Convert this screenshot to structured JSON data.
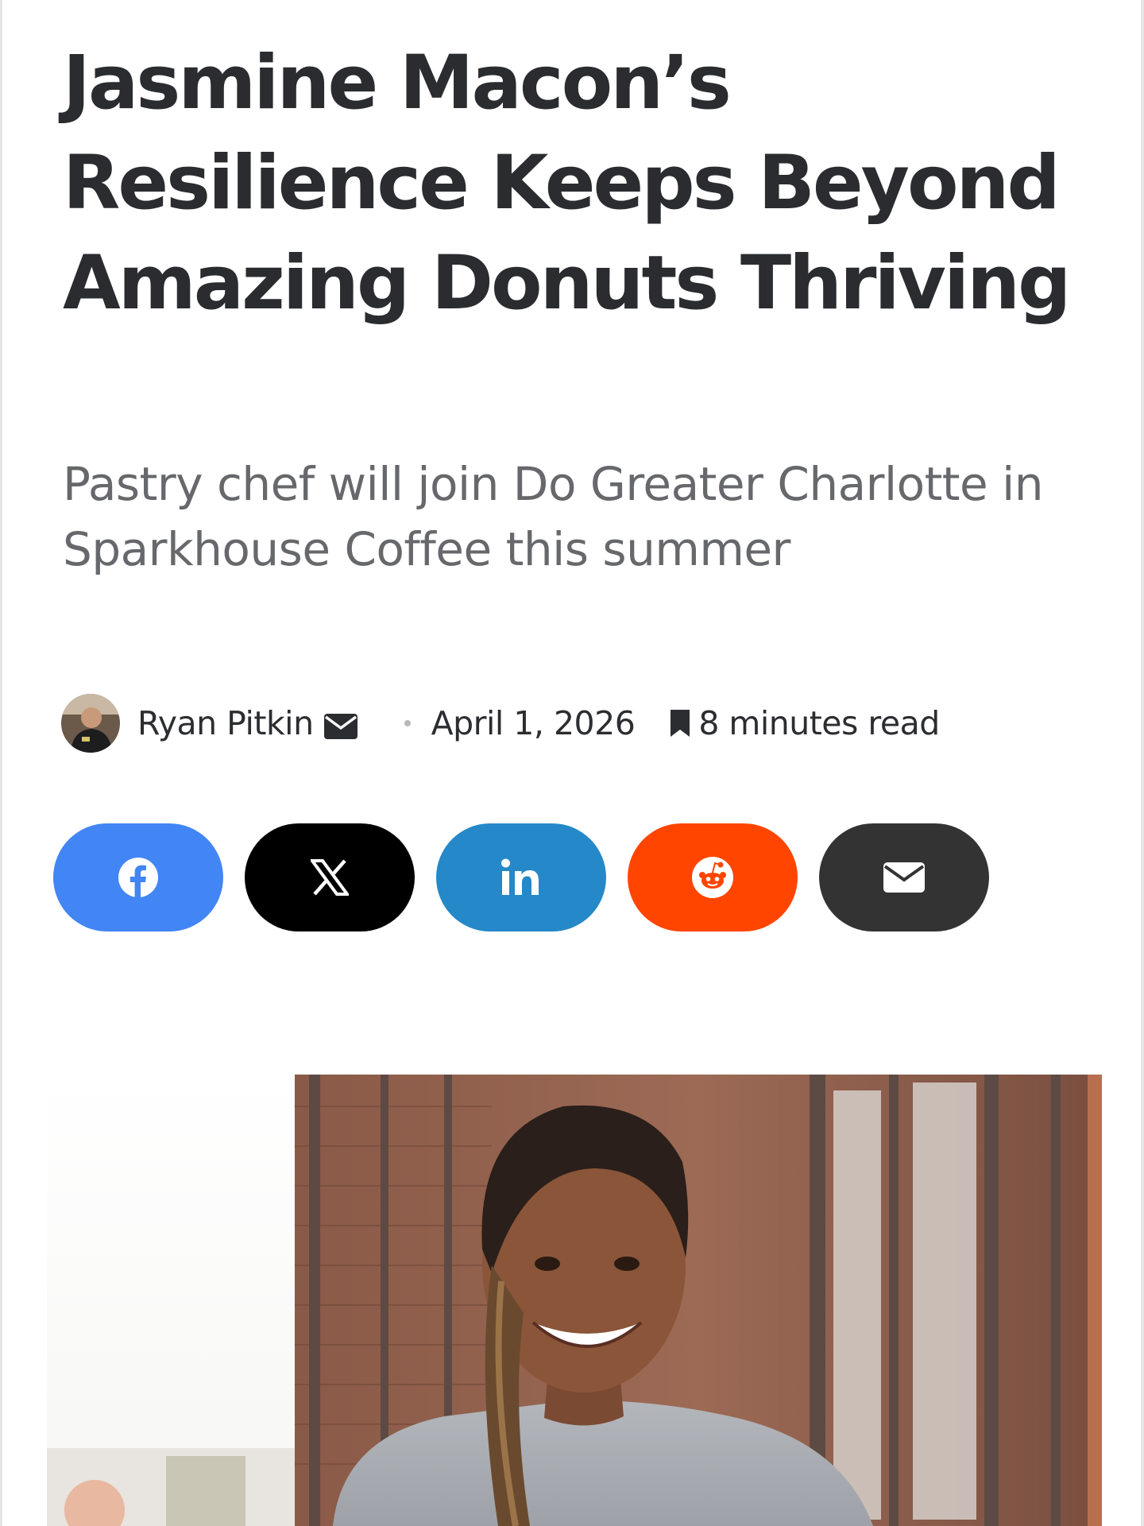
{
  "article": {
    "headline": "Jasmine Macon’s Resilience Keeps Beyond Amazing Donuts Thriving",
    "subheadline": "Pastry chef will join Do Greater Charlotte in Sparkhouse Coffee this summer"
  },
  "meta": {
    "author": "Ryan Pitkin",
    "date": "April 1, 2026",
    "read_time": "8 minutes read"
  },
  "share": {
    "buttons": [
      {
        "network": "facebook",
        "icon": "facebook-icon",
        "color": "#4285f4"
      },
      {
        "network": "x",
        "icon": "x-icon",
        "color": "#000000"
      },
      {
        "network": "linkedin",
        "icon": "linkedin-icon",
        "color": "#2588c8"
      },
      {
        "network": "reddit",
        "icon": "reddit-icon",
        "color": "#ff4500"
      },
      {
        "network": "email",
        "icon": "envelope-icon",
        "color": "#333333"
      }
    ]
  },
  "icons": {
    "author_contact": "envelope-icon",
    "read_time": "bookmark-icon"
  },
  "colors": {
    "headline": "#2a2c30",
    "subheadline": "#66686c"
  }
}
